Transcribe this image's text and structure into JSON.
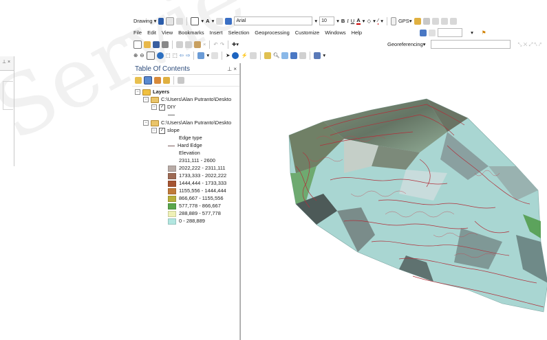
{
  "watermark": "Servie",
  "toolbar_drawing": {
    "drawing_label": "Drawing",
    "font_name": "Arial",
    "font_size": "10",
    "bold": "B",
    "italic": "I",
    "underline": "U",
    "text_color": "A",
    "gps_label": "GPS"
  },
  "menu": {
    "items": [
      "File",
      "Edit",
      "View",
      "Bookmarks",
      "Insert",
      "Selection",
      "Geoprocessing",
      "Customize",
      "Windows",
      "Help"
    ]
  },
  "georef": {
    "label": "Georeferencing"
  },
  "toc": {
    "title": "Table Of Contents",
    "pin": "     ",
    "close": "×",
    "layers_label": "Layers",
    "group1_path": "C:\\Users\\Alan Putranto\\Deskto",
    "layer1_name": "DIY",
    "group2_path": "C:\\Users\\Alan Putranto\\Deskto",
    "layer2_name": "slope",
    "edge_type_label": "Edge type",
    "hard_edge_label": "Hard Edge",
    "elevation_label": "Elevation",
    "legend": [
      {
        "label": "2311,111 - 2600",
        "color": "#ffffff"
      },
      {
        "label": "2022,222 - 2311,111",
        "color": "#b8aba6"
      },
      {
        "label": "1733,333 - 2022,222",
        "color": "#9e6a54"
      },
      {
        "label": "1444,444 - 1733,333",
        "color": "#a55432"
      },
      {
        "label": "1155,556 - 1444,444",
        "color": "#c07a3a"
      },
      {
        "label": "866,667 - 1155,556",
        "color": "#b8b03c"
      },
      {
        "label": "577,778 - 866,667",
        "color": "#5aa64c"
      },
      {
        "label": "288,889 - 577,778",
        "color": "#eef0b6"
      },
      {
        "label": "0 - 288,889",
        "color": "#b2e6e0"
      }
    ]
  },
  "colors": {
    "accent": "#2b4a7a",
    "map_low": "#a9d6d2",
    "map_contour": "#b0303a",
    "map_peak": "#6f7a64"
  }
}
